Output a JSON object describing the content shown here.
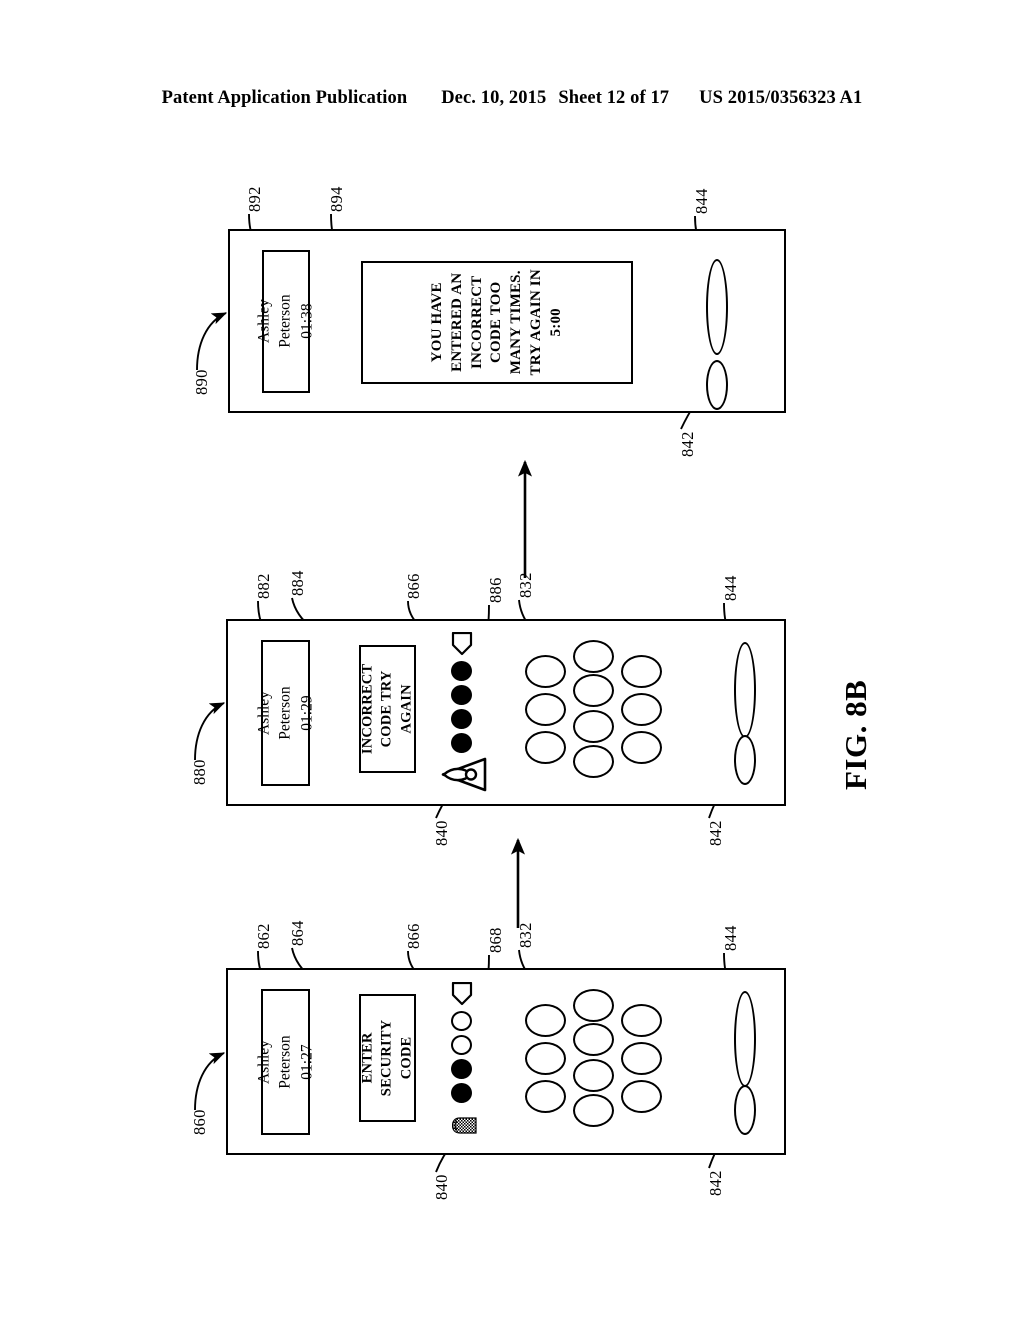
{
  "header": {
    "publication": "Patent Application Publication",
    "date": "Dec. 10, 2015",
    "sheet": "Sheet 12 of 17",
    "patent_number": "US 2015/0356323 A1"
  },
  "figure": {
    "label": "FIG. 8B"
  },
  "panels": [
    {
      "ref": "860",
      "state": "enter-security-code",
      "status_box": {
        "ref": "862",
        "caller_name": "Ashley Peterson",
        "timer": "01:27"
      },
      "message_box": {
        "ref": "864",
        "lines": [
          "ENTER",
          "SECURITY",
          "CODE"
        ]
      },
      "badge_icon": {
        "ref": "866",
        "name": "shield-icon"
      },
      "code_dots": {
        "ref": "868",
        "states": [
          "empty",
          "empty",
          "filled",
          "filled"
        ]
      },
      "keypad": {
        "ref": "832",
        "keys": 10
      },
      "sensor_icon": {
        "ref": "840",
        "name": "fingerprint-icon"
      },
      "button_long": {
        "ref": "844"
      },
      "button_short": {
        "ref": "842"
      }
    },
    {
      "ref": "880",
      "state": "incorrect-code",
      "status_box": {
        "ref": "882",
        "caller_name": "Ashley Peterson",
        "timer": "01:29"
      },
      "message_box": {
        "ref": "884",
        "lines": [
          "INCORRECT",
          "CODE TRY",
          "AGAIN"
        ]
      },
      "badge_icon": {
        "ref": "866",
        "name": "shield-icon"
      },
      "code_dots": {
        "ref": "886",
        "states": [
          "filled",
          "filled",
          "filled",
          "filled"
        ]
      },
      "keypad": {
        "ref": "832",
        "keys": 10
      },
      "sensor_icon": {
        "ref": "840",
        "name": "fingerprint-disabled-icon"
      },
      "button_long": {
        "ref": "844"
      },
      "button_short": {
        "ref": "842"
      }
    },
    {
      "ref": "890",
      "state": "lockout",
      "status_box": {
        "ref": "892",
        "caller_name": "Ashley Peterson",
        "timer": "01:38"
      },
      "message_box": {
        "ref": "894",
        "lines": [
          "YOU HAVE",
          "ENTERED AN",
          "INCORRECT",
          "CODE TOO",
          "MANY TIMES.",
          "TRY AGAIN IN",
          "5:00"
        ]
      },
      "button_long": {
        "ref": "844"
      },
      "button_short": {
        "ref": "842"
      }
    }
  ],
  "callouts": [
    {
      "id": "c890",
      "text": "890"
    },
    {
      "id": "c892",
      "text": "892"
    },
    {
      "id": "c894",
      "text": "894"
    },
    {
      "id": "c844a",
      "text": "844"
    },
    {
      "id": "c842a",
      "text": "842"
    },
    {
      "id": "c880",
      "text": "880"
    },
    {
      "id": "c882",
      "text": "882"
    },
    {
      "id": "c884",
      "text": "884"
    },
    {
      "id": "c866b",
      "text": "866"
    },
    {
      "id": "c886",
      "text": "886"
    },
    {
      "id": "c832b",
      "text": "832"
    },
    {
      "id": "c844b",
      "text": "844"
    },
    {
      "id": "c840b",
      "text": "840"
    },
    {
      "id": "c842b",
      "text": "842"
    },
    {
      "id": "c860",
      "text": "860"
    },
    {
      "id": "c862",
      "text": "862"
    },
    {
      "id": "c864",
      "text": "864"
    },
    {
      "id": "c866c",
      "text": "866"
    },
    {
      "id": "c868",
      "text": "868"
    },
    {
      "id": "c832c",
      "text": "832"
    },
    {
      "id": "c844c",
      "text": "844"
    },
    {
      "id": "c840c",
      "text": "840"
    },
    {
      "id": "c842c",
      "text": "842"
    }
  ]
}
